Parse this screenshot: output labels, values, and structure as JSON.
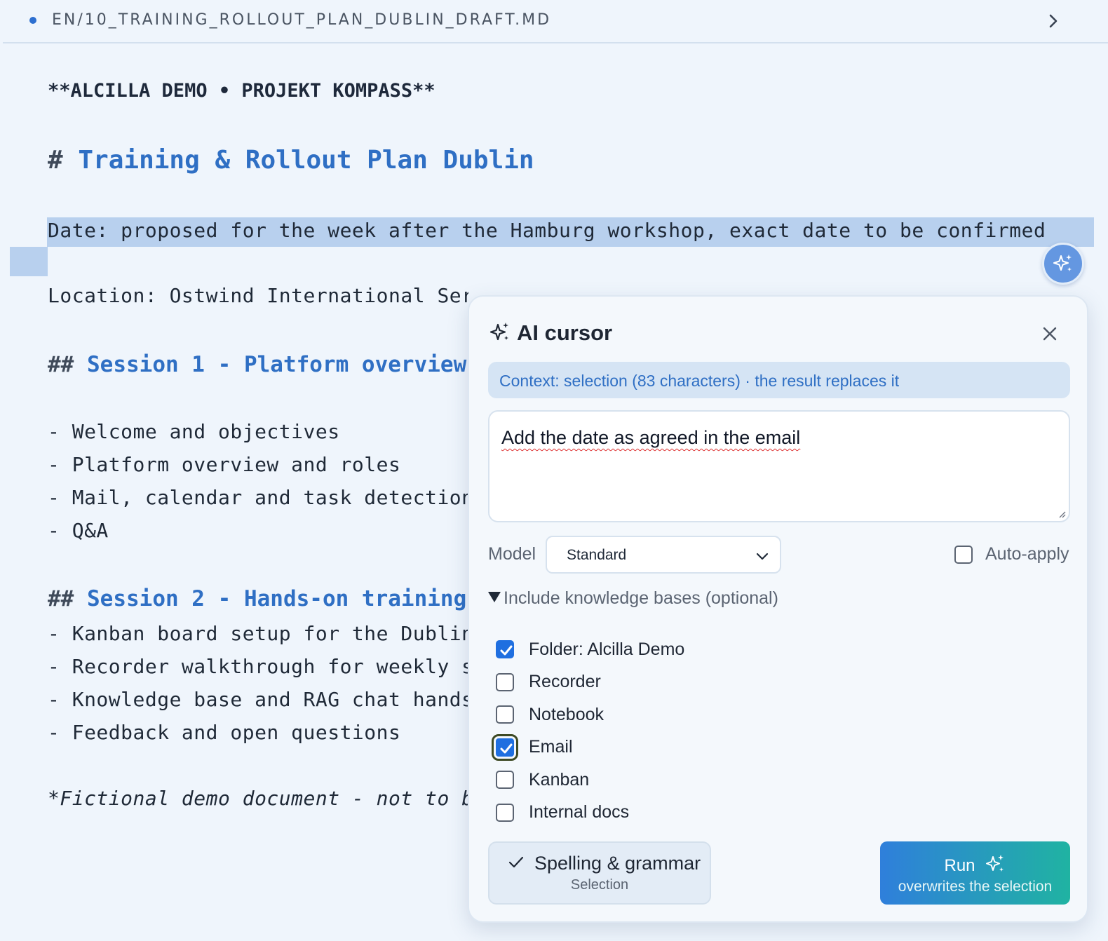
{
  "header": {
    "filename": "EN/10_TRAINING_ROLLOUT_PLAN_DUBLIN_DRAFT.MD"
  },
  "document": {
    "line_bold": "**ALCILLA DEMO • PROJEKT KOMPASS**",
    "h1_hash": "#",
    "h1_text": "Training & Rollout Plan Dublin",
    "date_line": "Date: proposed for the week after the Hamburg workshop, exact date to be confirmed",
    "location_line": "Location: Ostwind International Services, Dublin",
    "s1_hash": "##",
    "s1_title": "Session 1 - Platform overview",
    "s1_items": [
      "- Welcome and objectives",
      "- Platform overview and roles",
      "- Mail, calendar and task detection",
      "- Q&A"
    ],
    "s2_hash": "##",
    "s2_title": "Session 2 - Hands-on training",
    "s2_items": [
      "- Kanban board setup for the Dublin",
      "- Recorder walkthrough for weekly s",
      "- Knowledge base and RAG chat hands",
      "- Feedback and open questions"
    ],
    "footer_italic": "*Fictional demo document - not to b"
  },
  "panel": {
    "title": "AI cursor",
    "title_icon": "sparkles-icon",
    "close_icon": "close-icon",
    "context": "Context: selection (83 characters) · the result replaces it",
    "prompt_value": "Add the date as agreed in the email",
    "model_label": "Model",
    "model_selected": "Standard",
    "auto_apply_label": "Auto-apply",
    "auto_apply_checked": false,
    "kb_summary": "Include knowledge bases (optional)",
    "knowledge_bases": [
      {
        "label": "Folder: Alcilla Demo",
        "checked": true
      },
      {
        "label": "Recorder",
        "checked": false
      },
      {
        "label": "Notebook",
        "checked": false
      },
      {
        "label": "Email",
        "checked": true
      },
      {
        "label": "Kanban",
        "checked": false
      },
      {
        "label": "Internal docs",
        "checked": false
      }
    ],
    "spell_label": "Spelling & grammar",
    "spell_sub": "Selection",
    "run_label": "Run",
    "run_sub": "overwrites the selection"
  },
  "colors": {
    "accent": "#2f6fc4",
    "selection": "#b8d0ee",
    "run_gradient_start": "#2f7fdb",
    "run_gradient_end": "#20b3a2"
  }
}
